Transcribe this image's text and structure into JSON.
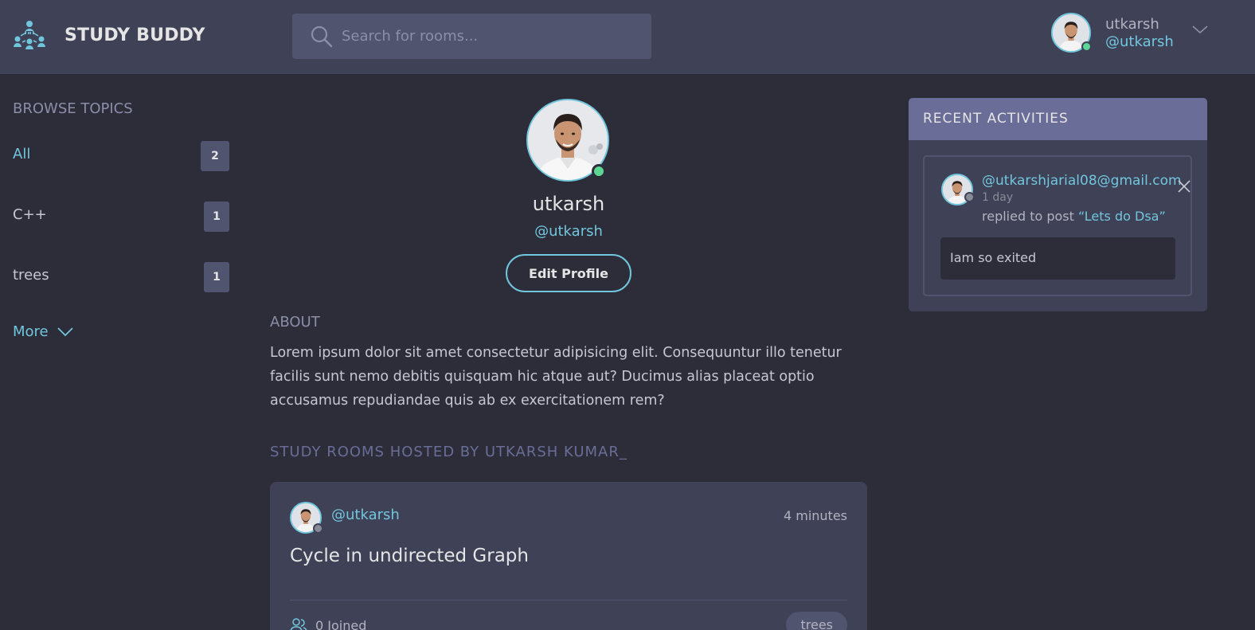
{
  "header": {
    "logo_text": "STUDY BUDDY",
    "search_placeholder": "Search for rooms...",
    "user": {
      "name": "utkarsh",
      "handle": "@utkarsh"
    }
  },
  "sidebar": {
    "title": "BROWSE TOPICS",
    "topics": [
      {
        "name": "All",
        "count": "2"
      },
      {
        "name": "C++",
        "count": "1"
      },
      {
        "name": "trees",
        "count": "1"
      }
    ],
    "more_label": "More"
  },
  "profile": {
    "name": "utkarsh",
    "handle": "@utkarsh",
    "edit_label": "Edit Profile",
    "about_title": "ABOUT",
    "about_text": "Lorem ipsum dolor sit amet consectetur adipisicing elit. Consequuntur illo tenetur facilis sunt nemo debitis quisquam hic atque aut? Ducimus alias placeat optio accusamus repudiandae quis ab ex exercitationem rem?",
    "rooms_title": "STUDY ROOMS HOSTED BY UTKARSH KUMAR_"
  },
  "room": {
    "host": "@utkarsh",
    "time": "4 minutes",
    "title": "Cycle in undirected Graph",
    "joined": "0 Joined",
    "tag": "trees"
  },
  "activities": {
    "title": "RECENT ACTIVITIES",
    "items": [
      {
        "user": "@utkarshjarial08@gmail.com",
        "time": "1 day",
        "action": "replied to post ",
        "post": "“Lets do Dsa”",
        "reply": "Iam so exited"
      }
    ]
  },
  "colors": {
    "background": "#2d2d39",
    "panel": "#3f4156",
    "accent": "#71c6dd",
    "online": "#5dd693",
    "activity_header": "#696d97"
  }
}
